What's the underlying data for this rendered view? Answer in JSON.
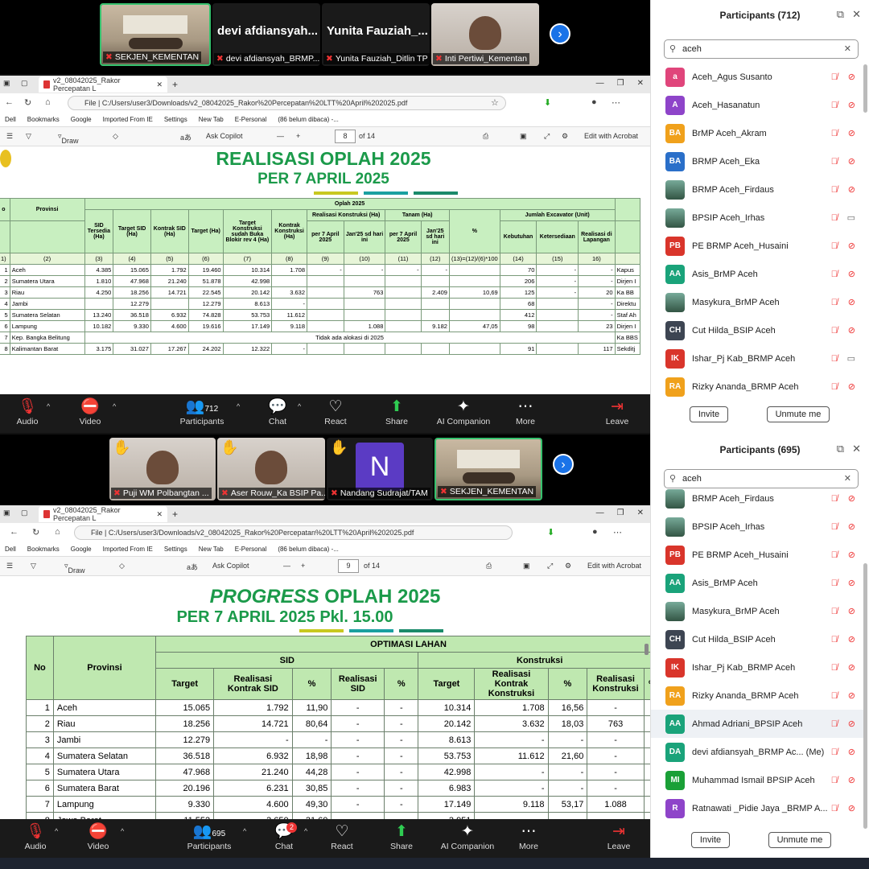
{
  "top": {
    "tiles": [
      {
        "caption": "SEKJEN_KEMENTAN",
        "kind": "room",
        "active": true
      },
      {
        "bigname": "devi afdiansyah...",
        "caption": "devi afdiansyah_BRMP..."
      },
      {
        "bigname": "Yunita Fauziah_...",
        "caption": "Yunita Fauziah_Ditlin TP"
      },
      {
        "caption": "Inti Pertiwi_Kementan",
        "kind": "face"
      }
    ],
    "tab_title": "v2_08042025_Rakor Percepatan L",
    "url": "C:/Users/user3/Downloads/v2_08042025_Rakor%20Percepatan%20LTT%20April%202025.pdf",
    "page_num": "8",
    "page_total": "of 14",
    "doc_title": "REALISASI OPLAH 2025",
    "doc_subtitle": "PER 7 APRIL 2025",
    "table": {
      "group_header": "Oplah 2025",
      "h_realisasi": "Realisasi Konstruksi  (Ha)",
      "h_tanam": "Tanam (Ha)",
      "h_excavator": "Jumlah Excavator (Unit)",
      "headers": [
        "o",
        "Provinsi",
        "SID Tersedia (Ha)",
        "Target SID (Ha)",
        "Kontrak SID (Ha)",
        "Target (Ha)",
        "Target Konstruksi sudah Buka Blokir rev 4 (Ha)",
        "Kontrak Konstruksi (Ha)",
        "per 7 April 2025",
        "Jan'25 sd hari ini",
        "per 7 April 2025",
        "Jan'25 sd hari ini",
        "%",
        "Kebutuhan",
        "Ketersediaan",
        "Realisasi di Lapangan"
      ],
      "colnums": [
        "1)",
        "(2)",
        "(3)",
        "(4)",
        "(5)",
        "(6)",
        "(7)",
        "(8)",
        "(9)",
        "(10)",
        "(11)",
        "(12)",
        "(13)=(12)/(6)*100",
        "(14)",
        "(15)",
        "16)",
        ""
      ],
      "rows": [
        [
          "1",
          "Aceh",
          "4.385",
          "15.065",
          "1.792",
          "19.460",
          "10.314",
          "1.708",
          "-",
          "-",
          "-",
          "-",
          "",
          "70",
          "-",
          "-",
          "Kapus"
        ],
        [
          "2",
          "Sumatera Utara",
          "1.810",
          "47.968",
          "21.240",
          "51.878",
          "42.998",
          "",
          "",
          "",
          "",
          "",
          "",
          "206",
          "-",
          "-",
          "Dirjen I"
        ],
        [
          "3",
          "Riau",
          "4.250",
          "18.256",
          "14.721",
          "22.545",
          "20.142",
          "3.632",
          "",
          "763",
          "",
          "2.409",
          "10,69",
          "125",
          "-",
          "20",
          "Ka BB"
        ],
        [
          "4",
          "Jambi",
          "",
          "12.279",
          "",
          "12.279",
          "8.613",
          "-",
          "",
          "",
          "",
          "",
          "",
          "68",
          "",
          "-",
          "Direktu"
        ],
        [
          "5",
          "Sumatera Selatan",
          "13.240",
          "36.518",
          "6.932",
          "74.828",
          "53.753",
          "11.612",
          "",
          "",
          "",
          "",
          "",
          "412",
          "",
          "-",
          "Staf Ah"
        ],
        [
          "6",
          "Lampung",
          "10.182",
          "9.330",
          "4.600",
          "19.616",
          "17.149",
          "9.118",
          "",
          "1.088",
          "",
          "9.182",
          "47,05",
          "98",
          "",
          "23",
          "Dirjen I"
        ],
        [
          "7",
          "Kep. Bangka Belitung",
          "",
          "",
          "",
          "",
          "",
          "",
          "",
          "",
          "",
          "",
          "",
          "",
          "",
          "",
          "Ka BBS"
        ],
        [
          "8",
          "Kalimantan Barat",
          "3.175",
          "31.027",
          "17.267",
          "24.202",
          "12.322",
          "-",
          "",
          "",
          "",
          "",
          "",
          "91",
          "",
          "117",
          "Sekditj"
        ]
      ],
      "no_alloc": "Tidak ada alokasi di 2025"
    },
    "zoom": {
      "audio": "Audio",
      "video": "Video",
      "participants": "Participants",
      "count": "712",
      "chat": "Chat",
      "react": "React",
      "share": "Share",
      "ai": "AI Companion",
      "more": "More",
      "leave": "Leave"
    },
    "panel": {
      "title": "Participants (712)",
      "search": "aceh",
      "items": [
        {
          "initials": "a",
          "color": "#e0457b",
          "name": "Aceh_Agus Susanto"
        },
        {
          "initials": "A",
          "color": "#8e44c9",
          "name": "Aceh_Hasanatun"
        },
        {
          "initials": "BA",
          "color": "#f0a11c",
          "name": "BrMP Aceh_Akram"
        },
        {
          "initials": "BA",
          "color": "#2a6fc9",
          "name": "BRMP Aceh_Eka"
        },
        {
          "initials": "",
          "color": "photo",
          "name": "BRMP Aceh_Firdaus"
        },
        {
          "initials": "",
          "color": "photo",
          "name": "BPSIP Aceh_Irhas",
          "cam_on": true
        },
        {
          "initials": "PB",
          "color": "#d9352b",
          "name": "PE BRMP Aceh_Husaini"
        },
        {
          "initials": "AA",
          "color": "#1aa37a",
          "name": "Asis_BrMP Aceh"
        },
        {
          "initials": "",
          "color": "photo",
          "name": "Masykura_BrMP Aceh"
        },
        {
          "initials": "CH",
          "color": "#3d4552",
          "name": "Cut Hilda_BSIP Aceh"
        },
        {
          "initials": "IK",
          "color": "#d9352b",
          "name": "Ishar_Pj Kab_BRMP Aceh",
          "cam_on": true
        },
        {
          "initials": "RA",
          "color": "#f0a11c",
          "name": "Rizky Ananda_BRMP Aceh"
        }
      ],
      "invite": "Invite",
      "unmute": "Unmute me"
    }
  },
  "bottom": {
    "tiles": [
      {
        "caption": "Puji WM Polbangtan ...",
        "kind": "face",
        "hand": true
      },
      {
        "caption": "Aser Rouw_Ka BSIP Pa...",
        "kind": "face",
        "hand": true
      },
      {
        "caption": "Nandang Sudrajat/TAM",
        "kind": "N",
        "hand": true
      },
      {
        "caption": "SEKJEN_KEMENTAN",
        "kind": "room",
        "active": true
      }
    ],
    "tab_title": "v2_08042025_Rakor Percepatan L",
    "url": "C:/Users/user3/Downloads/v2_08042025_Rakor%20Percepatan%20LTT%20April%202025.pdf",
    "page_num": "9",
    "page_total": "of 14",
    "doc_title_a": "PROGRESS",
    "doc_title_b": " OPLAH 2025",
    "doc_subtitle": "PER 7 APRIL 2025 Pkl. 15.00",
    "table": {
      "opt": "OPTIMASI LAHAN",
      "sid": "SID",
      "konstruksi": "Konstruksi",
      "h_no": "No",
      "h_prov": "Provinsi",
      "headers": [
        "Target",
        "Realisasi Kontrak SID",
        "%",
        "Realisasi SID",
        "%",
        "Target",
        "Realisasi Kontrak Konstruksi",
        "%",
        "Realisasi Konstruksi",
        "%"
      ],
      "rows": [
        [
          "1",
          "Aceh",
          "15.065",
          "1.792",
          "11,90",
          "-",
          "-",
          "10.314",
          "1.708",
          "16,56",
          "-"
        ],
        [
          "2",
          "Riau",
          "18.256",
          "14.721",
          "80,64",
          "-",
          "-",
          "20.142",
          "3.632",
          "18,03",
          "763"
        ],
        [
          "3",
          "Jambi",
          "12.279",
          "-",
          "-",
          "-",
          "-",
          "8.613",
          "-",
          "-",
          "-"
        ],
        [
          "4",
          "Sumatera Selatan",
          "36.518",
          "6.932",
          "18,98",
          "-",
          "-",
          "53.753",
          "11.612",
          "21,60",
          "-"
        ],
        [
          "5",
          "Sumatera Utara",
          "47.968",
          "21.240",
          "44,28",
          "-",
          "-",
          "42.998",
          "-",
          "-",
          "-"
        ],
        [
          "6",
          "Sumatera Barat",
          "20.196",
          "6.231",
          "30,85",
          "-",
          "-",
          "6.983",
          "-",
          "-",
          "-"
        ],
        [
          "7",
          "Lampung",
          "9.330",
          "4.600",
          "49,30",
          "-",
          "-",
          "17.149",
          "9.118",
          "53,17",
          "1.088"
        ],
        [
          "8",
          "Jawa Barat",
          "11.552",
          "3.650",
          "31,60",
          "-",
          "-",
          "3.951",
          "-",
          "-",
          "-"
        ]
      ]
    },
    "zoom": {
      "audio": "Audio",
      "video": "Video",
      "participants": "Participants",
      "count": "695",
      "chat": "Chat",
      "chat_badge": "2",
      "react": "React",
      "share": "Share",
      "ai": "AI Companion",
      "more": "More",
      "leave": "Leave"
    },
    "panel": {
      "title": "Participants (695)",
      "search": "aceh",
      "items": [
        {
          "initials": "",
          "color": "photo",
          "name": "BRMP Aceh_Firdaus"
        },
        {
          "initials": "",
          "color": "photo",
          "name": "BPSIP Aceh_Irhas"
        },
        {
          "initials": "PB",
          "color": "#d9352b",
          "name": "PE BRMP Aceh_Husaini"
        },
        {
          "initials": "AA",
          "color": "#1aa37a",
          "name": "Asis_BrMP Aceh"
        },
        {
          "initials": "",
          "color": "photo",
          "name": "Masykura_BrMP Aceh"
        },
        {
          "initials": "CH",
          "color": "#3d4552",
          "name": "Cut Hilda_BSIP Aceh"
        },
        {
          "initials": "IK",
          "color": "#d9352b",
          "name": "Ishar_Pj Kab_BRMP Aceh"
        },
        {
          "initials": "RA",
          "color": "#f0a11c",
          "name": "Rizky Ananda_BRMP Aceh"
        },
        {
          "initials": "AA",
          "color": "#1aa37a",
          "name": "Ahmad Adriani_BPSIP Aceh",
          "hl": true
        },
        {
          "initials": "DA",
          "color": "#1aa37a",
          "name": "devi afdiansyah_BRMP Ac... (Me)"
        },
        {
          "initials": "MI",
          "color": "#1aa037",
          "name": "Muhammad Ismail BPSIP Aceh"
        },
        {
          "initials": "R",
          "color": "#8e44c9",
          "name": "Ratnawati _Pidie Jaya _BRMP A..."
        }
      ],
      "invite": "Invite",
      "unmute": "Unmute me"
    }
  },
  "browser_common": {
    "file_label": "File",
    "bookmarks": [
      "Dell",
      "Bookmarks",
      "Google",
      "Imported From IE",
      "Settings",
      "New Tab",
      "E-Personal",
      "(86 belum dibaca) -..."
    ],
    "draw": "Draw",
    "ask_copilot": "Ask Copilot",
    "edit_acrobat": "Edit with Acrobat"
  },
  "colors": {
    "doc_green": "#1b9a4a",
    "zoom_red": "#e33333",
    "share_green": "#2fcc52"
  }
}
